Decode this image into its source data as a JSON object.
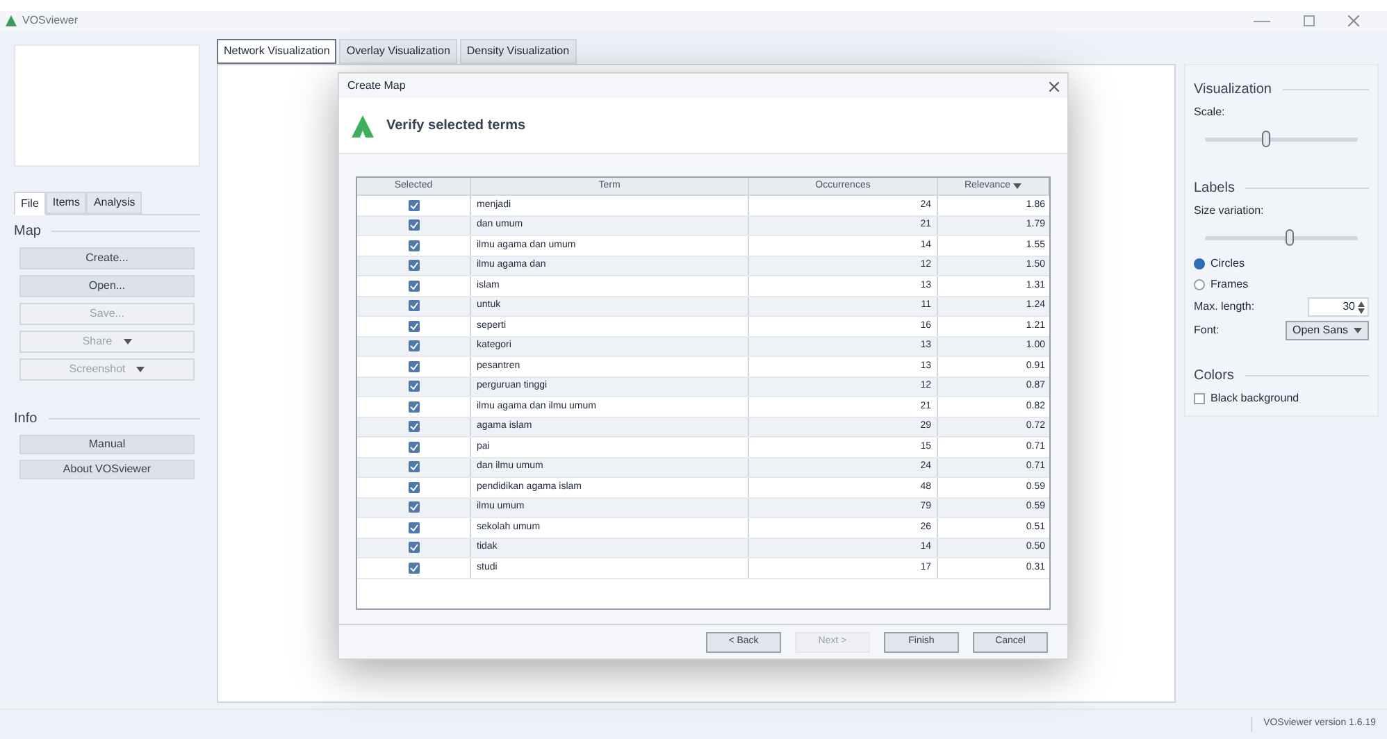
{
  "window": {
    "title": "VOSviewer"
  },
  "left_tabs": [
    {
      "label": "File",
      "selected": true
    },
    {
      "label": "Items",
      "selected": false
    },
    {
      "label": "Analysis",
      "selected": false
    }
  ],
  "map_section": {
    "title": "Map",
    "buttons": [
      {
        "label": "Create...",
        "disabled": false,
        "dropdown": false
      },
      {
        "label": "Open...",
        "disabled": false,
        "dropdown": false
      },
      {
        "label": "Save...",
        "disabled": true,
        "dropdown": false
      },
      {
        "label": "Share",
        "disabled": true,
        "dropdown": true
      },
      {
        "label": "Screenshot",
        "disabled": true,
        "dropdown": true
      }
    ]
  },
  "info_section": {
    "title": "Info",
    "buttons": [
      {
        "label": "Manual"
      },
      {
        "label": "About VOSviewer"
      }
    ]
  },
  "main_tabs": [
    {
      "label": "Network Visualization",
      "selected": true
    },
    {
      "label": "Overlay Visualization",
      "selected": false
    },
    {
      "label": "Density Visualization",
      "selected": false
    }
  ],
  "dialog": {
    "title": "Create Map",
    "heading": "Verify selected terms",
    "columns": [
      {
        "label": "Selected",
        "sorted": false
      },
      {
        "label": "Term",
        "sorted": false
      },
      {
        "label": "Occurrences",
        "sorted": false
      },
      {
        "label": "Relevance",
        "sorted": true
      }
    ],
    "rows": [
      {
        "checked": true,
        "term": "menjadi",
        "occurrences": "24",
        "relevance": "1.86"
      },
      {
        "checked": true,
        "term": "dan umum",
        "occurrences": "21",
        "relevance": "1.79"
      },
      {
        "checked": true,
        "term": "ilmu agama dan umum",
        "occurrences": "14",
        "relevance": "1.55"
      },
      {
        "checked": true,
        "term": "ilmu agama dan",
        "occurrences": "12",
        "relevance": "1.50"
      },
      {
        "checked": true,
        "term": "islam",
        "occurrences": "13",
        "relevance": "1.31"
      },
      {
        "checked": true,
        "term": "untuk",
        "occurrences": "11",
        "relevance": "1.24"
      },
      {
        "checked": true,
        "term": "seperti",
        "occurrences": "16",
        "relevance": "1.21"
      },
      {
        "checked": true,
        "term": "kategori",
        "occurrences": "13",
        "relevance": "1.00"
      },
      {
        "checked": true,
        "term": "pesantren",
        "occurrences": "13",
        "relevance": "0.91"
      },
      {
        "checked": true,
        "term": "perguruan tinggi",
        "occurrences": "12",
        "relevance": "0.87"
      },
      {
        "checked": true,
        "term": "ilmu agama dan ilmu umum",
        "occurrences": "21",
        "relevance": "0.82"
      },
      {
        "checked": true,
        "term": "agama islam",
        "occurrences": "29",
        "relevance": "0.72"
      },
      {
        "checked": true,
        "term": "pai",
        "occurrences": "15",
        "relevance": "0.71"
      },
      {
        "checked": true,
        "term": "dan ilmu umum",
        "occurrences": "24",
        "relevance": "0.71"
      },
      {
        "checked": true,
        "term": "pendidikan agama islam",
        "occurrences": "48",
        "relevance": "0.59"
      },
      {
        "checked": true,
        "term": "ilmu umum",
        "occurrences": "79",
        "relevance": "0.59"
      },
      {
        "checked": true,
        "term": "sekolah umum",
        "occurrences": "26",
        "relevance": "0.51"
      },
      {
        "checked": true,
        "term": "tidak",
        "occurrences": "14",
        "relevance": "0.50"
      },
      {
        "checked": true,
        "term": "studi",
        "occurrences": "17",
        "relevance": "0.31"
      }
    ],
    "buttons": [
      {
        "label": "< Back",
        "disabled": false
      },
      {
        "label": "Next >",
        "disabled": true
      },
      {
        "label": "Finish",
        "disabled": false
      },
      {
        "label": "Cancel",
        "disabled": false
      }
    ]
  },
  "right_panel": {
    "visualization_title": "Visualization",
    "scale_label": "Scale:",
    "scale": {
      "level": 0.4
    },
    "labels_title": "Labels",
    "size_variation_label": "Size variation:",
    "size_variation": {
      "level": 0.55
    },
    "label_modes": [
      {
        "label": "Circles",
        "selected": true
      },
      {
        "label": "Frames",
        "selected": false
      }
    ],
    "max_length_label": "Max. length:",
    "max_length": "30",
    "font_label": "Font:",
    "font": "Open Sans",
    "colors_title": "Colors",
    "black_background": {
      "label": "Black background",
      "checked": false
    }
  },
  "status_bar": {
    "text": "VOSviewer version 1.6.19"
  }
}
